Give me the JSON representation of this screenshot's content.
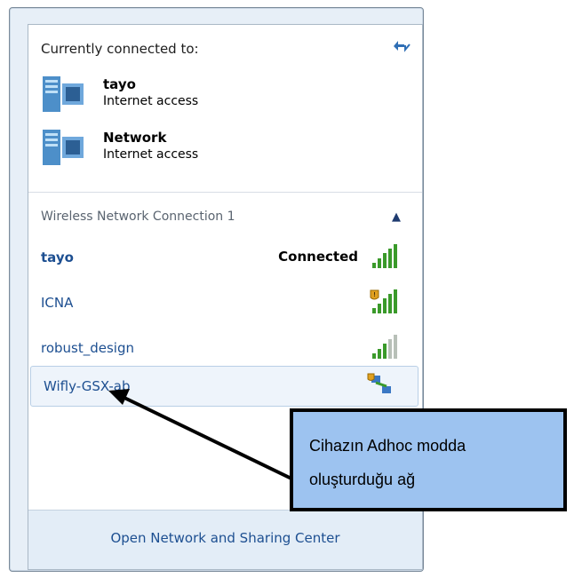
{
  "flyout": {
    "header": "Currently connected to:",
    "connected": [
      {
        "name": "tayo",
        "status": "Internet access"
      },
      {
        "name": "Network",
        "status": "Internet access"
      }
    ],
    "section_title": "Wireless Network Connection 1",
    "networks": [
      {
        "name": "tayo",
        "status": "Connected"
      },
      {
        "name": "ICNA"
      },
      {
        "name": "robust_design"
      },
      {
        "name": "Wifly-GSX-ab"
      }
    ],
    "footer_link": "Open Network and Sharing Center"
  },
  "callout": {
    "line1": "Cihazın Adhoc modda",
    "line2": "oluşturduğu ağ"
  },
  "colors": {
    "link_blue": "#1d4f91",
    "callout_fill": "#9dc3f0",
    "signal_green": "#3a9a2a"
  }
}
